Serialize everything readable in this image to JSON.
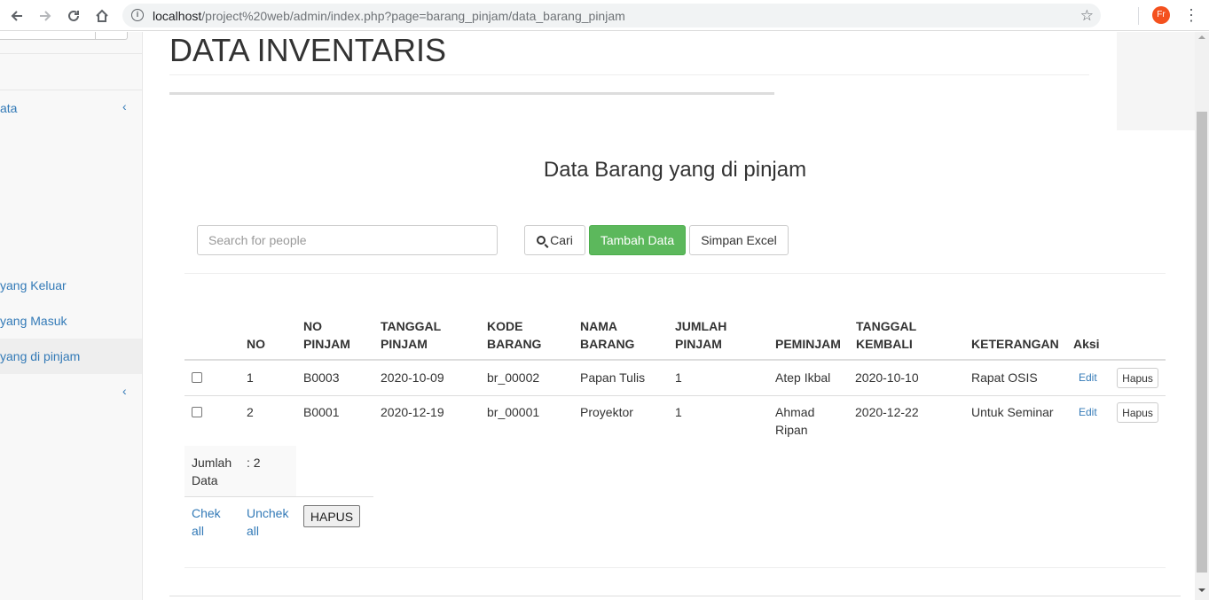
{
  "browser": {
    "url_host": "localhost",
    "url_path": "/project%20web/admin/index.php?page=barang_pinjam/data_barang_pinjam",
    "profile_initials": "Fr"
  },
  "sidebar": {
    "items": [
      {
        "label": "ata"
      },
      {
        "label": "yang Keluar"
      },
      {
        "label": "yang Masuk"
      },
      {
        "label": "yang di pinjam"
      }
    ]
  },
  "page": {
    "title": "DATA INVENTARIS",
    "panel_title": "Data Barang yang di pinjam"
  },
  "toolbar": {
    "search_placeholder": "Search for people",
    "cari_label": "Cari",
    "tambah_label": "Tambah Data",
    "excel_label": "Simpan Excel"
  },
  "table": {
    "headers": {
      "no": "NO",
      "no_pinjam_1": "NO",
      "no_pinjam_2": "PINJAM",
      "tanggal_pinjam_1": "TANGGAL",
      "tanggal_pinjam_2": "PINJAM",
      "kode_barang_1": "KODE",
      "kode_barang_2": "BARANG",
      "nama_barang_1": "NAMA",
      "nama_barang_2": "BARANG",
      "jumlah_pinjam_1": "JUMLAH",
      "jumlah_pinjam_2": "PINJAM",
      "peminjam": "PEMINJAM",
      "tanggal_kembali_1": "TANGGAL",
      "tanggal_kembali_2": "KEMBALI",
      "keterangan": "KETERANGAN",
      "aksi": "Aksi"
    },
    "rows": [
      {
        "no": "1",
        "no_pinjam": "B0003",
        "tanggal_pinjam": "2020-10-09",
        "kode_barang": "br_00002",
        "nama_barang": "Papan Tulis",
        "jumlah": "1",
        "peminjam_1": "Atep Ikbal",
        "peminjam_2": "",
        "tanggal_kembali": "2020-10-10",
        "keterangan": "Rapat OSIS",
        "edit": "Edit",
        "hapus": "Hapus"
      },
      {
        "no": "2",
        "no_pinjam": "B0001",
        "tanggal_pinjam": "2020-12-19",
        "kode_barang": "br_00001",
        "nama_barang": "Proyektor",
        "jumlah": "1",
        "peminjam_1": "Ahmad",
        "peminjam_2": "Ripan",
        "tanggal_kembali": "2020-12-22",
        "keterangan": "Untuk Seminar",
        "edit": "Edit",
        "hapus": "Hapus"
      }
    ]
  },
  "summary": {
    "label_1": "Jumlah",
    "label_2": "Data",
    "value": ": 2",
    "check_all_1": "Chek",
    "check_all_2": "all",
    "uncheck_all_1": "Unchek",
    "uncheck_all_2": "all",
    "hapus_label": "HAPUS"
  }
}
